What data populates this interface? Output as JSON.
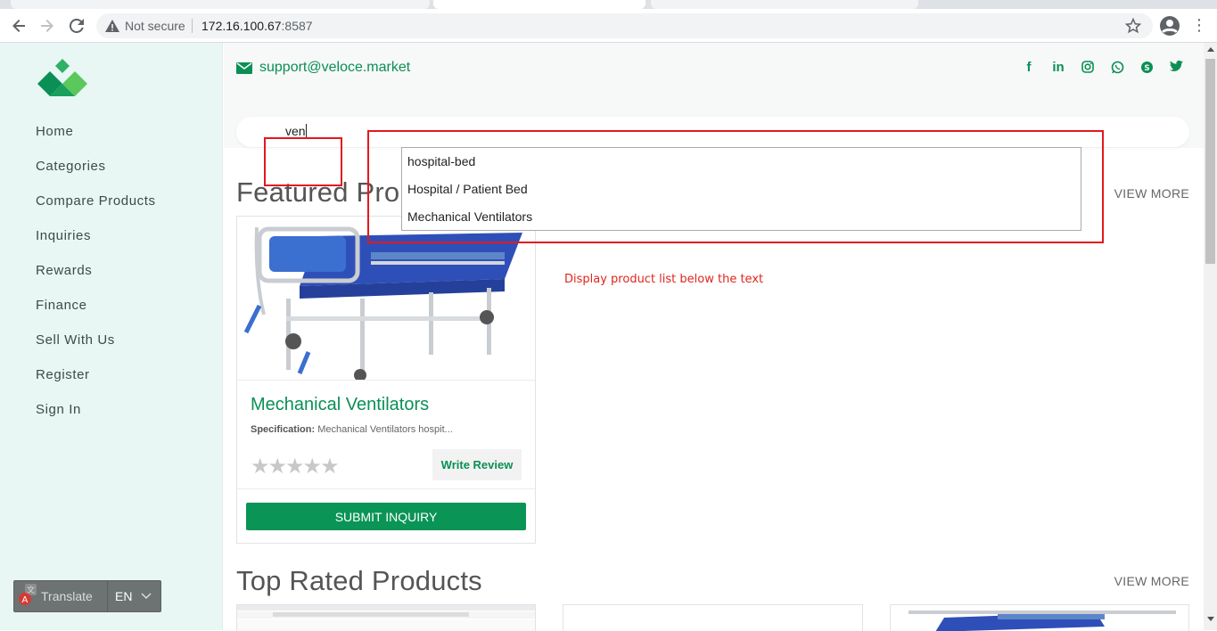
{
  "browser": {
    "security_label": "Not secure",
    "url_host": "172.16.100.67",
    "url_port": ":8587"
  },
  "sidebar": {
    "items": [
      {
        "label": "Home"
      },
      {
        "label": "Categories"
      },
      {
        "label": "Compare Products"
      },
      {
        "label": "Inquiries"
      },
      {
        "label": "Rewards"
      },
      {
        "label": "Finance"
      },
      {
        "label": "Sell With Us"
      },
      {
        "label": "Register"
      },
      {
        "label": "Sign In"
      }
    ],
    "translate": {
      "label": "Translate",
      "language": "EN"
    }
  },
  "header": {
    "email": "support@veloce.market",
    "socials": [
      "facebook-icon",
      "linkedin-icon",
      "instagram-icon",
      "whatsapp-icon",
      "skype-icon",
      "twitter-icon"
    ]
  },
  "search": {
    "query": "ven",
    "suggestions": [
      "hospital-bed",
      "Hospital / Patient Bed",
      "Mechanical Ventilators"
    ]
  },
  "featured": {
    "title": "Featured Pro",
    "view_more": "VIEW MORE",
    "product": {
      "name": "Mechanical Ventilators",
      "spec_label": "Specification:",
      "spec_value": "Mechanical Ventilators hospit...",
      "rating_display": "★★★★★",
      "review_button": "Write Review",
      "submit_button": "SUBMIT INQUIRY"
    }
  },
  "annotation": "Display product list below the text",
  "top_rated": {
    "title": "Top Rated Products",
    "view_more": "VIEW MORE"
  },
  "colors": {
    "brand_green": "#0a8f55",
    "sidebar_bg": "#e8f7f4",
    "annotation_red": "#e4181f"
  }
}
